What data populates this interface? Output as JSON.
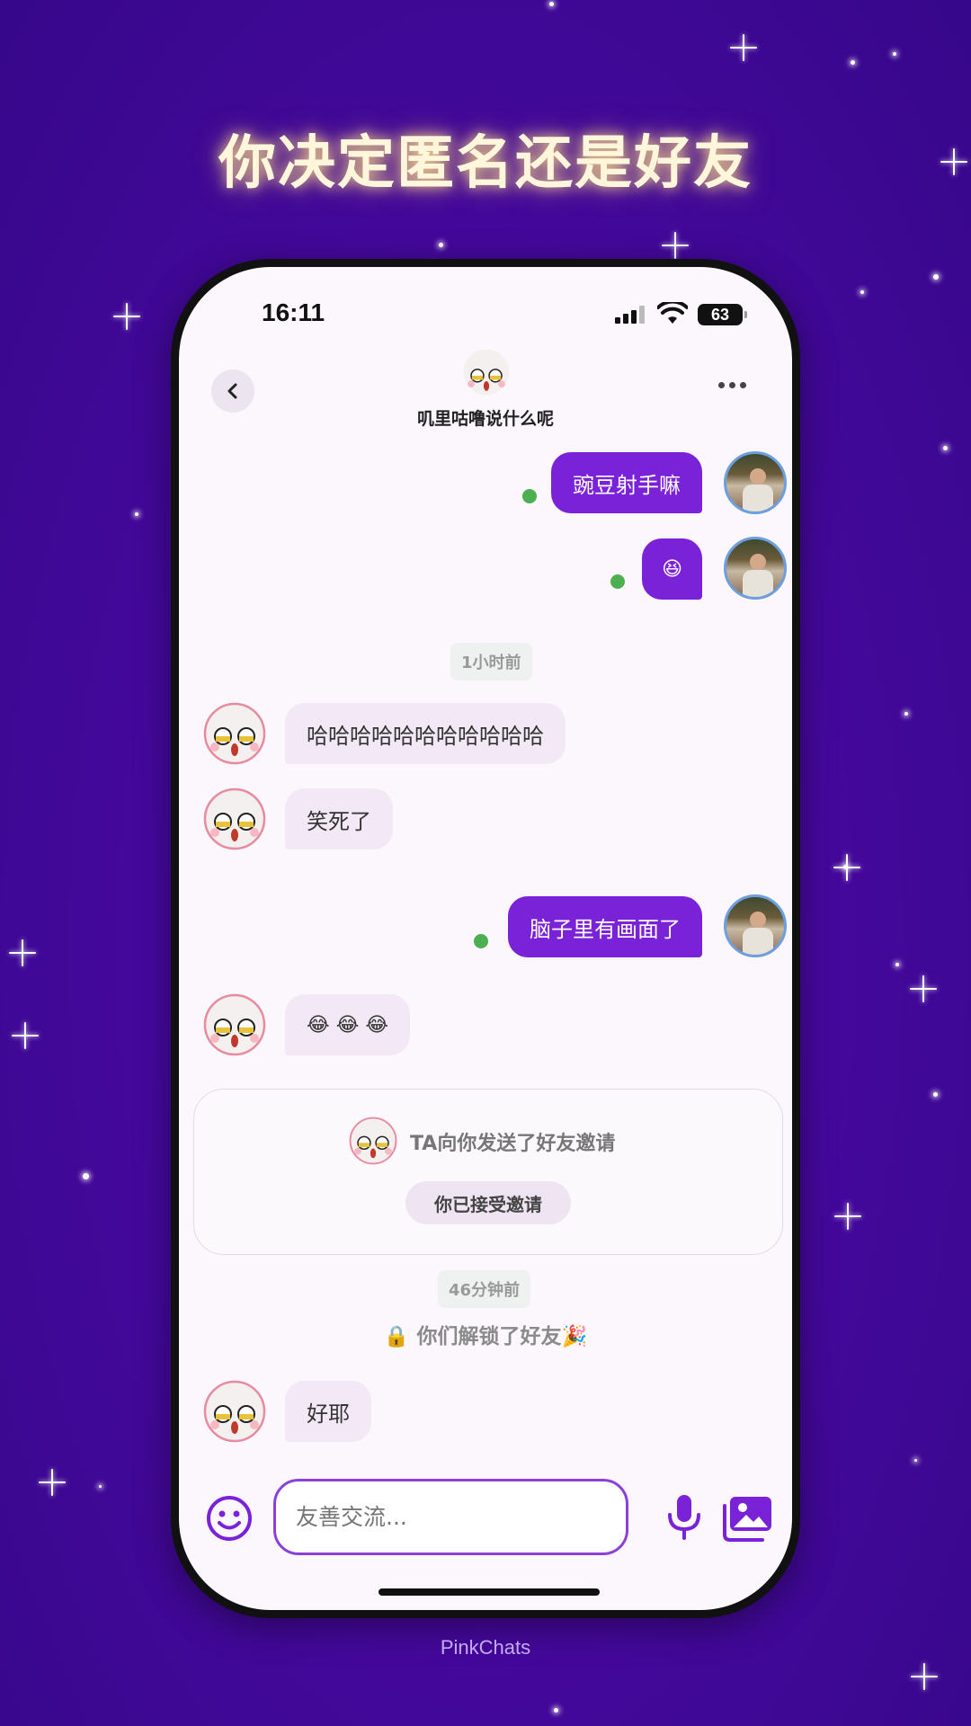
{
  "headline": "你决定匿名还是好友",
  "brand": "PinkChats",
  "status_bar": {
    "time": "16:11",
    "battery": "63"
  },
  "header": {
    "title": "叽里咕噜说什么呢"
  },
  "messages": {
    "m1": "豌豆射手嘛",
    "m2": "😆",
    "time1": "1小时前",
    "m3": "哈哈哈哈哈哈哈哈哈哈哈",
    "m4": "笑死了",
    "m5": "脑子里有画面了",
    "m6": "😂 😂 😂",
    "time2": "46分钟前",
    "m7": "好耶"
  },
  "invite": {
    "text": "TA向你发送了好友邀请",
    "button": "你已接受邀请"
  },
  "unlock": "🔒 你们解锁了好友🎉",
  "input": {
    "placeholder": "友善交流..."
  },
  "colors": {
    "accent": "#7a22d8",
    "incoming_bubble": "#f3e8f6",
    "online_dot": "#4caf50",
    "background": "#46089e"
  }
}
